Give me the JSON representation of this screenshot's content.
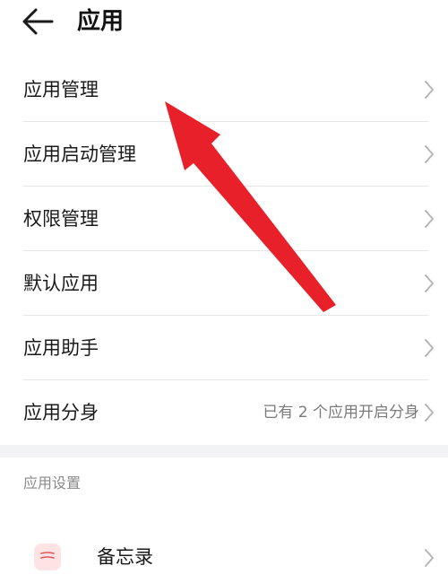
{
  "header": {
    "title": "应用",
    "back_icon": "arrow-left-icon"
  },
  "settings_list": [
    {
      "label": "应用管理",
      "value": ""
    },
    {
      "label": "应用启动管理",
      "value": ""
    },
    {
      "label": "权限管理",
      "value": ""
    },
    {
      "label": "默认应用",
      "value": ""
    },
    {
      "label": "应用助手",
      "value": ""
    },
    {
      "label": "应用分身",
      "value": "已有 2 个应用开启分身"
    }
  ],
  "app_settings": {
    "section_title": "应用设置",
    "items": [
      {
        "label": "备忘录",
        "icon": "memo-icon",
        "icon_color": "#fde3e3"
      }
    ]
  },
  "annotation": {
    "icon": "red-arrow-icon",
    "color": "#e8202a"
  }
}
